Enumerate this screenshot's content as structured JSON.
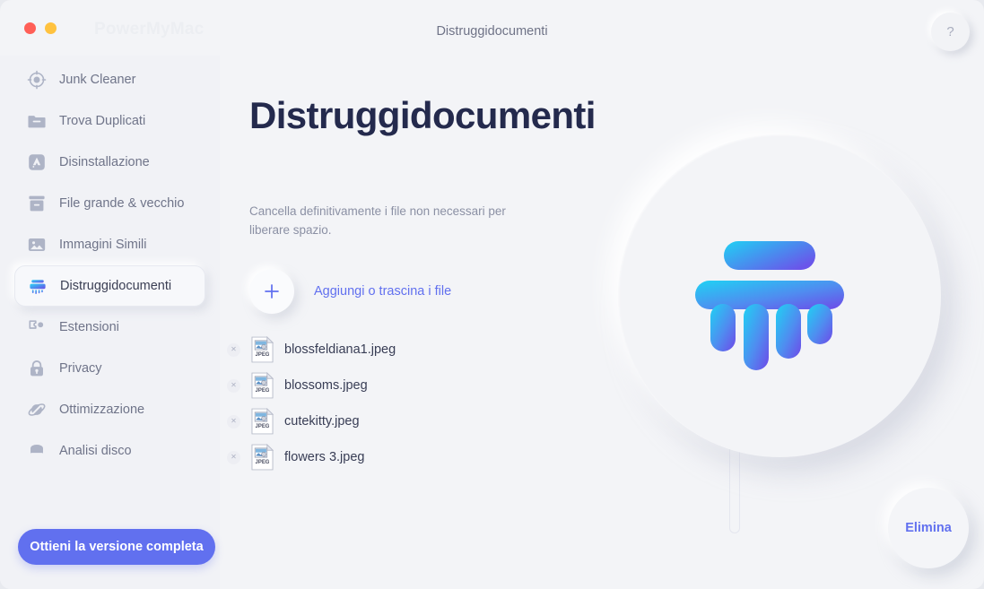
{
  "window": {
    "brand": "PowerMyMac",
    "title": "Distruggidocumenti",
    "help_label": "?",
    "traffic_lights": [
      {
        "name": "close",
        "color": "#ff5f57"
      },
      {
        "name": "minimize",
        "color": "#ffc23f"
      }
    ]
  },
  "sidebar": {
    "items": [
      {
        "label": "Junk Cleaner",
        "icon": "junk-cleaner-icon",
        "active": false
      },
      {
        "label": "Trova Duplicati",
        "icon": "folder-icon",
        "active": false
      },
      {
        "label": "Disinstallazione",
        "icon": "app-store-icon",
        "active": false
      },
      {
        "label": "File grande & vecchio",
        "icon": "archive-box-icon",
        "active": false
      },
      {
        "label": "Immagini Simili",
        "icon": "image-icon",
        "active": false
      },
      {
        "label": "Distruggidocumenti",
        "icon": "shredder-icon",
        "active": true
      },
      {
        "label": "Estensioni",
        "icon": "puzzle-piece-icon",
        "active": false
      },
      {
        "label": "Privacy",
        "icon": "lock-icon",
        "active": false
      },
      {
        "label": "Ottimizzazione",
        "icon": "optimization-icon",
        "active": false
      },
      {
        "label": "Analisi disco",
        "icon": "disk-icon",
        "active": false
      }
    ],
    "upgrade_button": "Ottieni la versione completa"
  },
  "main": {
    "title": "Distruggidocumenti",
    "subtitle": "Cancella definitivamente i file non necessari per liberare spazio.",
    "add_label": "Aggiungi o trascina i file",
    "add_icon": "plus-icon",
    "hero_icon": "shredder-illustration",
    "delete_button": "Elimina",
    "files": [
      {
        "name": "blossfeldiana1.jpeg",
        "type": "JPEG"
      },
      {
        "name": "blossoms.jpeg",
        "type": "JPEG"
      },
      {
        "name": "cutekitty.jpeg",
        "type": "JPEG"
      },
      {
        "name": "flowers 3.jpeg",
        "type": "JPEG"
      }
    ]
  },
  "colors": {
    "accent": "#6170ef",
    "background": "#f3f4f7",
    "sidebar": "#f1f2f6",
    "title_text": "#242a4d",
    "muted_text": "#8b90a4",
    "gradient_start": "#22d3f0",
    "gradient_end": "#6e49e8"
  }
}
